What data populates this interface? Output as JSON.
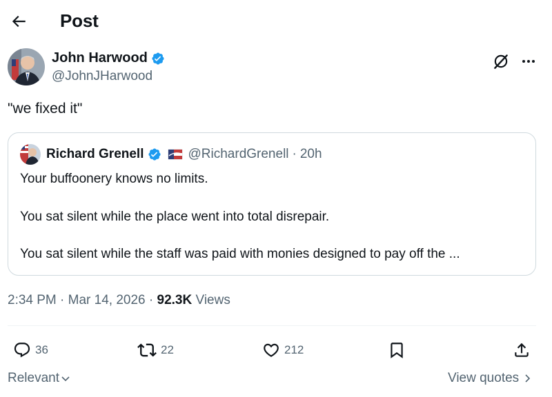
{
  "header": {
    "title": "Post",
    "back_icon": "arrow-left-icon"
  },
  "author": {
    "name": "John Harwood",
    "handle": "@JohnJHarwood",
    "verified": true
  },
  "post": {
    "text": "\"we fixed it\""
  },
  "quote": {
    "name": "Richard Grenell",
    "handle": "@RichardGrenell",
    "separator": "·",
    "time": "20h",
    "lines": [
      "Your buffoonery knows no limits.",
      "You sat silent while the place went into total disrepair.",
      "You sat silent while the staff was paid with monies designed to pay off the ..."
    ]
  },
  "meta": {
    "time": "2:34 PM",
    "sep1": "·",
    "date": "Mar 14, 2026",
    "sep2": "·",
    "views_count": "92.3K",
    "views_label": "Views"
  },
  "actions": {
    "replies": "36",
    "reposts": "22",
    "likes": "212"
  },
  "footer": {
    "sort_label": "Relevant",
    "quotes_label": "View quotes"
  },
  "colors": {
    "text": "#0f1419",
    "secondary": "#536471",
    "verified": "#1d9bf0",
    "border": "#cfd9de"
  }
}
